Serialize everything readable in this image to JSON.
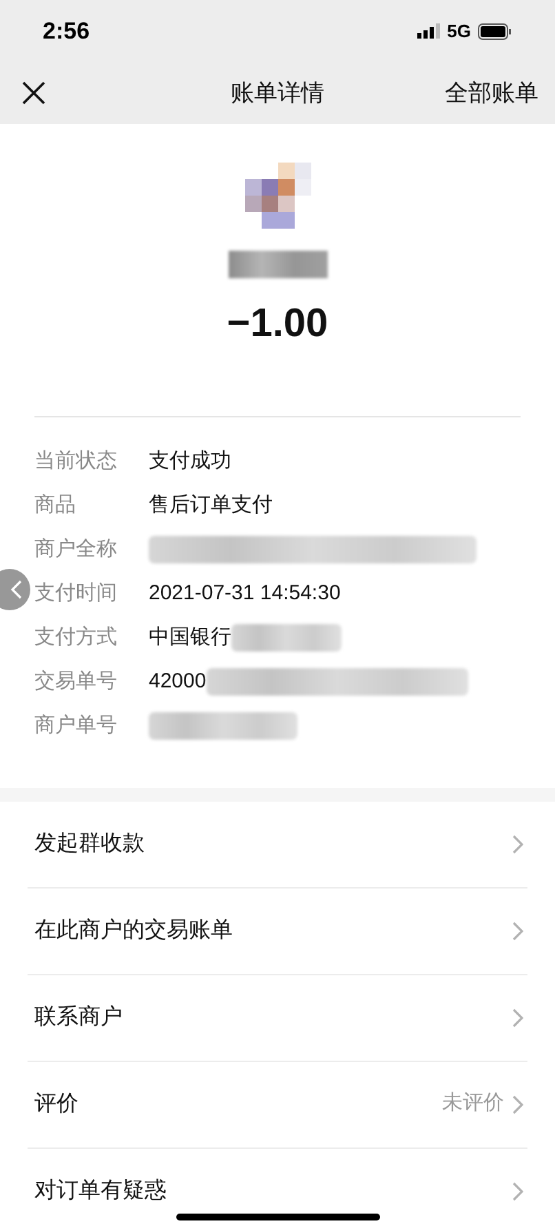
{
  "status_bar": {
    "time": "2:56",
    "network": "5G"
  },
  "nav": {
    "title": "账单详情",
    "action": "全部账单"
  },
  "amount": "−1.00",
  "details": [
    {
      "kind": "text",
      "label": "当前状态",
      "value": "支付成功"
    },
    {
      "kind": "text",
      "label": "商品",
      "value": "售后订单支付"
    },
    {
      "kind": "redacted",
      "label": "商户全称"
    },
    {
      "kind": "text",
      "label": "支付时间",
      "value": "2021-07-31 14:54:30"
    },
    {
      "kind": "partial",
      "label": "支付方式",
      "value": "中国银行"
    },
    {
      "kind": "partial",
      "label": "交易单号",
      "value": "42000"
    },
    {
      "kind": "redacted",
      "label": "商户单号"
    }
  ],
  "menu": [
    {
      "label": "发起群收款"
    },
    {
      "label": "在此商户的交易账单"
    },
    {
      "label": "联系商户"
    },
    {
      "label": "评价",
      "status": "未评价"
    },
    {
      "label": "对订单有疑惑"
    }
  ]
}
